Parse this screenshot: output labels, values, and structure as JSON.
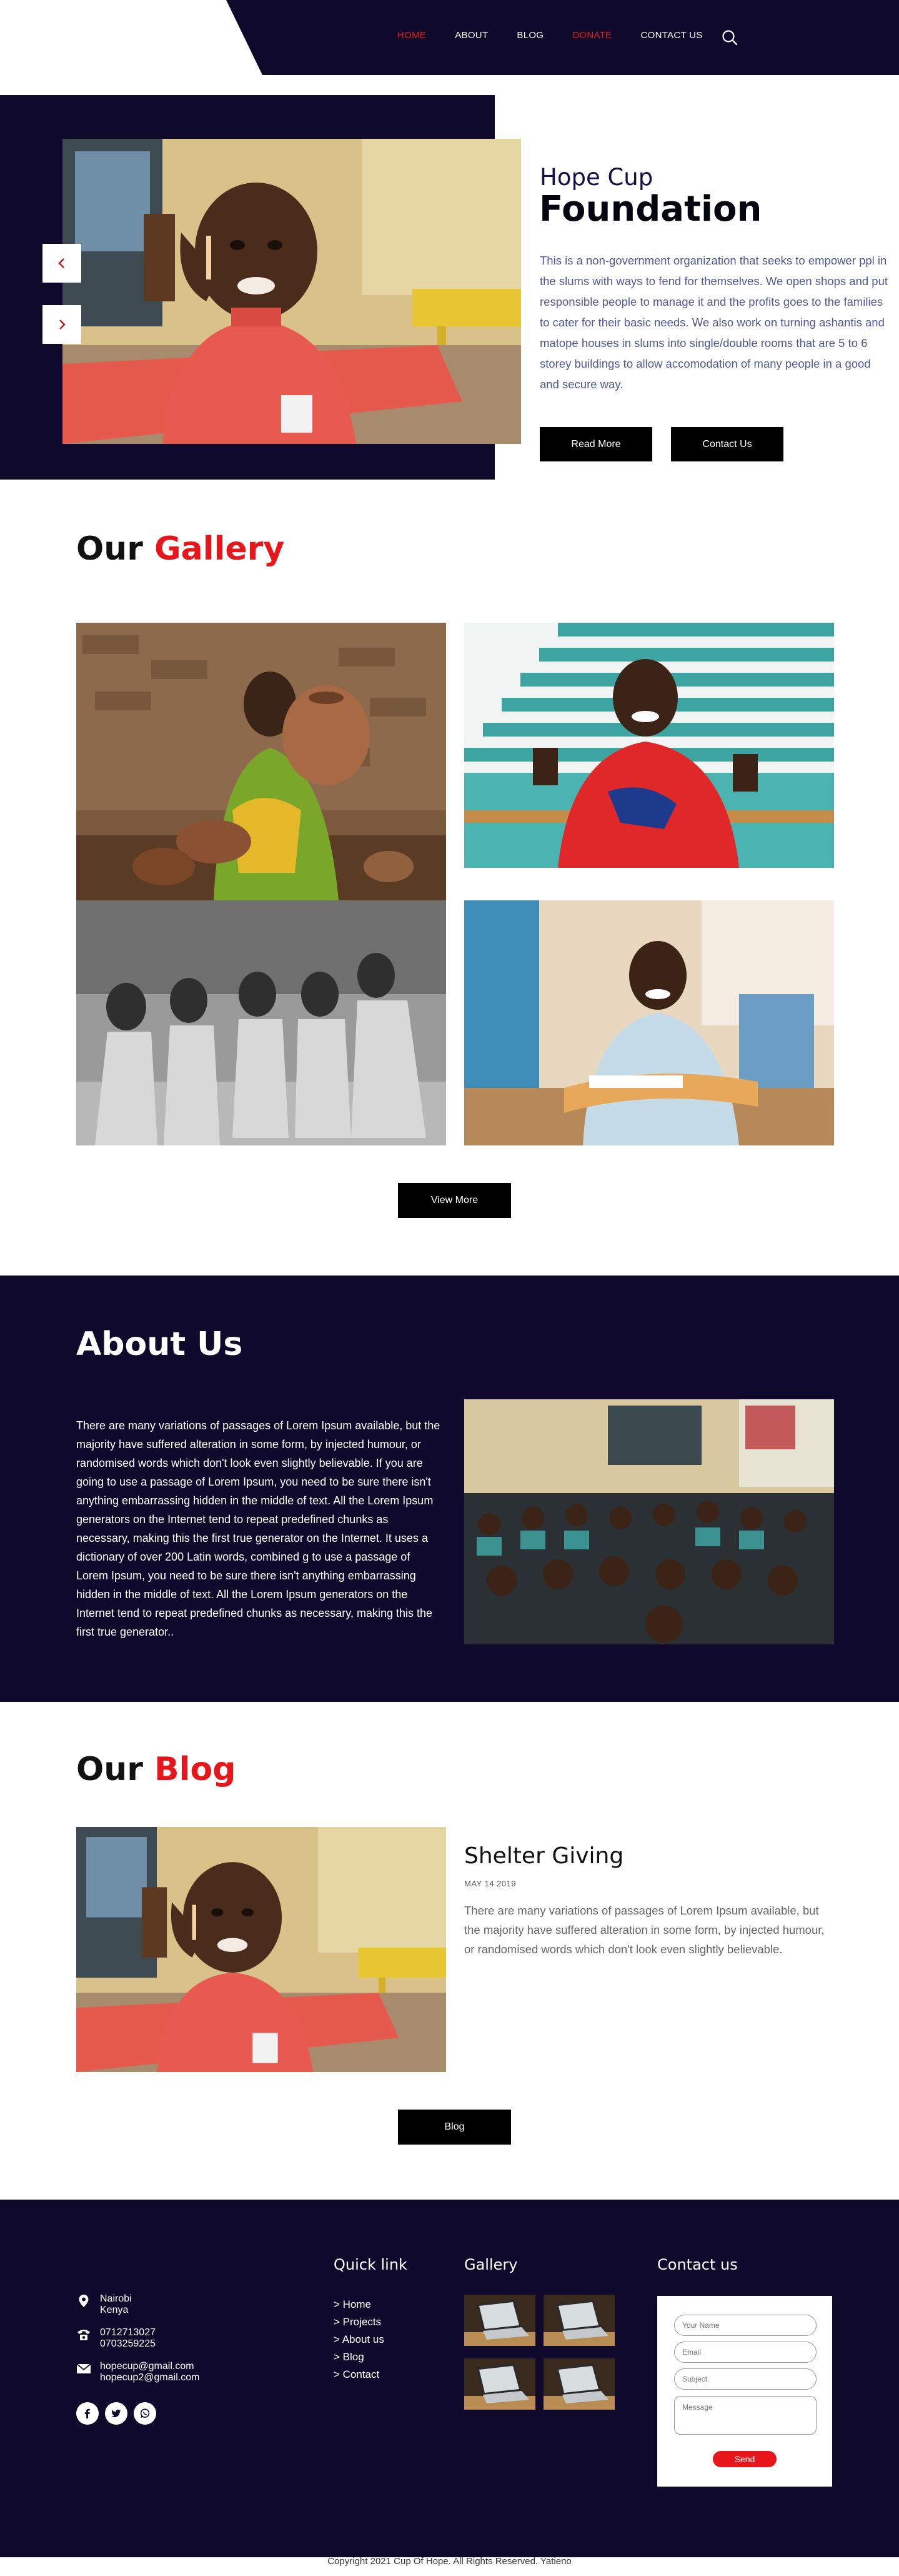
{
  "nav": {
    "links": [
      "HOME",
      "ABOUT",
      "BLOG",
      "DONATE",
      "CONTACT US"
    ],
    "search_icon": "search-icon"
  },
  "hero": {
    "subtitle": "Hope Cup",
    "title": "Foundation",
    "text": "This is a non-government organization that seeks to empower ppl in the slums with ways to fend for themselves. We open shops and put responsible people to manage it and the profits goes to the families to cater for their basic needs. We also work on turning ashantis and matope houses in slums into single/double rooms that are 5 to 6 storey buildings to allow accomodation of many people in a good and secure way.",
    "read_more": "Read More",
    "contact_us": "Contact Us",
    "prev_icon": "chevron-left-icon",
    "next_icon": "chevron-right-icon"
  },
  "gallery": {
    "title_dark": "Our",
    "title_red": "Gallery",
    "view_more": "View More"
  },
  "about": {
    "title": "About Us",
    "text": "There are many variations of passages of Lorem Ipsum available, but the majority have suffered alteration in some form, by injected humour, or randomised words which don't look even slightly believable. If you are going to use a passage of Lorem Ipsum, you need to be sure there isn't anything embarrassing hidden in the middle of text. All the Lorem Ipsum generators on the Internet tend to repeat predefined chunks as necessary, making this the first true generator on the Internet. It uses a dictionary of over 200 Latin words, combined g to use a passage of Lorem Ipsum, you need to be sure there isn't anything embarrassing hidden in the middle of text. All the Lorem Ipsum generators on the Internet tend to repeat predefined chunks as necessary, making this the first true generator.."
  },
  "blog": {
    "title_dark": "Our",
    "title_red": "Blog",
    "post_title": "Shelter Giving",
    "post_date": "MAY 14 2019",
    "post_text": "There are many variations of passages of Lorem Ipsum available, but the majority have suffered alteration in some form, by injected humour, or randomised words which don't look even slightly believable.",
    "button": "Blog"
  },
  "footer": {
    "location_line1": "Nairobi",
    "location_line2": "Kenya",
    "phone1": "0712713027",
    "phone2": "0703259225",
    "email1": "hopecup@gmail.com",
    "email2": "hopecup2@gmail.com",
    "quick_link_title": "Quick link",
    "quick_links": [
      "> Home",
      "> Projects",
      "> About us",
      "> Blog",
      "> Contact"
    ],
    "gallery_title": "Gallery",
    "contact_title": "Contact us",
    "form": {
      "name_placeholder": "Your Name",
      "email_placeholder": "Email",
      "subject_placeholder": "Subject",
      "message_placeholder": "Message",
      "send": "Send"
    },
    "socials": [
      "facebook-icon",
      "twitter-icon",
      "whatsapp-icon"
    ],
    "copyright": "Copyright 2021 Cup Of Hope. All Rights Reserved. Yatieno"
  },
  "colors": {
    "navy": "#0f0a2c",
    "accent_red": "#e8161b",
    "hero_text": "#4f5896",
    "hero_subtitle": "#15104a"
  }
}
